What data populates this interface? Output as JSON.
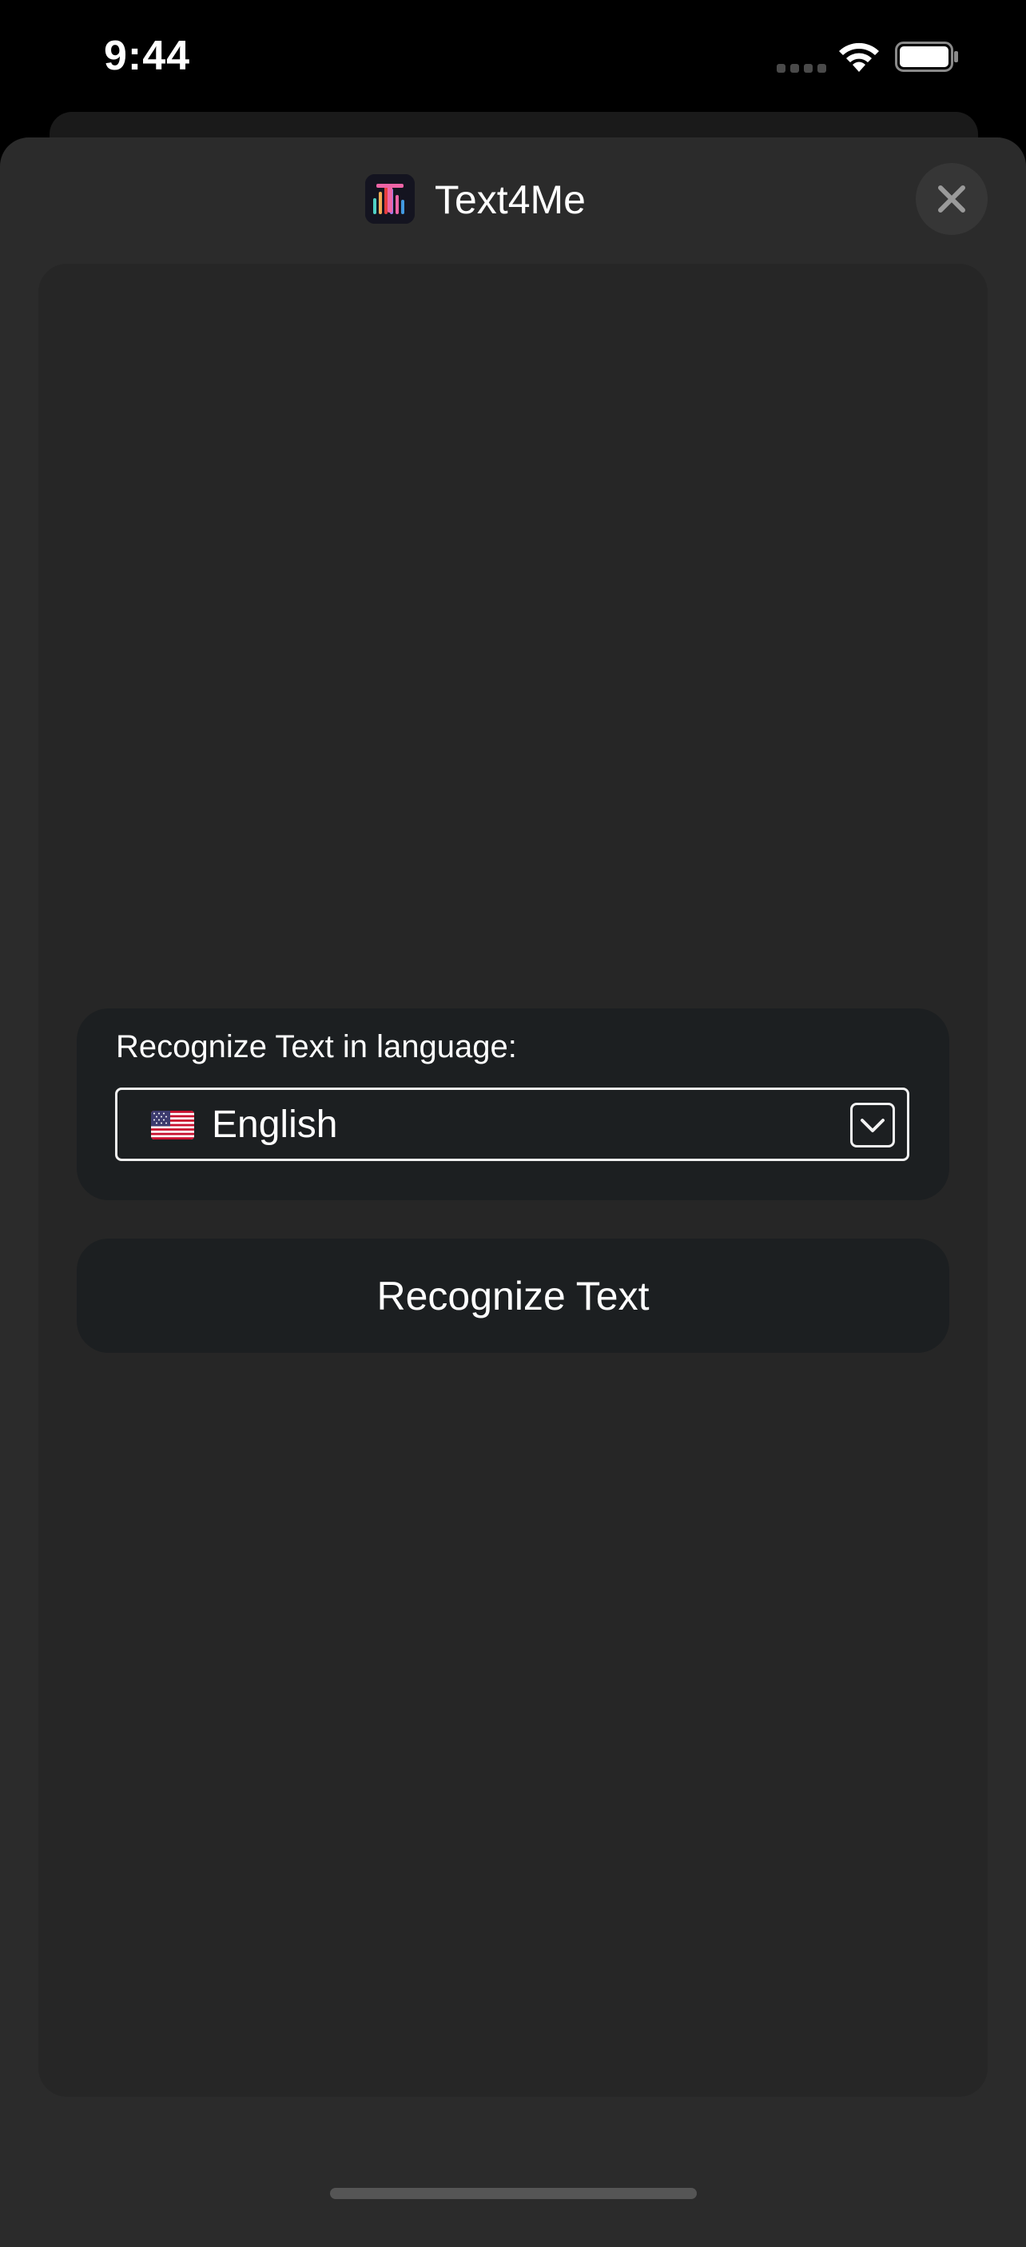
{
  "status_bar": {
    "time": "9:44"
  },
  "header": {
    "app_logo_icon": "text4me-logo-icon",
    "title": "Text4Me",
    "close_icon": "close-icon"
  },
  "language_picker": {
    "label": "Recognize Text in language:",
    "flag_icon": "us-flag-icon",
    "selected_language": "English",
    "dropdown_icon": "chevron-down-icon"
  },
  "actions": {
    "recognize_label": "Recognize Text"
  },
  "colors": {
    "background": "#000000",
    "sheet": "#2b2b2b",
    "panel": "#262626",
    "card": "#1c1f21",
    "text": "#ffffff"
  }
}
